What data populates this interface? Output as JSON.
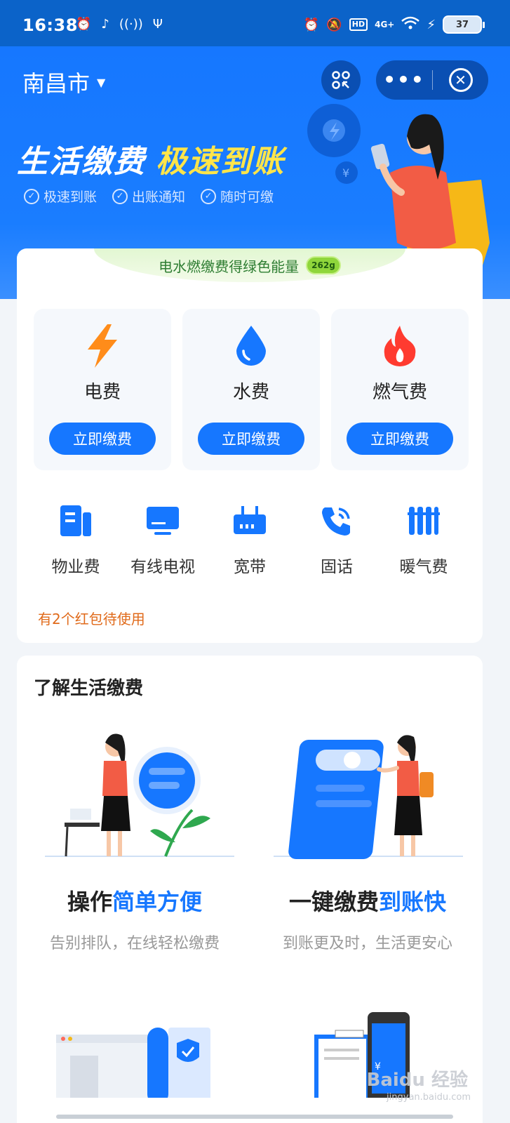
{
  "status_bar": {
    "time": "16:38",
    "battery": "37",
    "hd": "HD",
    "net": "4G+"
  },
  "header": {
    "city": "南昌市",
    "more_label": "•••"
  },
  "hero": {
    "headline_a": "生活缴费",
    "headline_b": "极速到账",
    "features": [
      "极速到账",
      "出账通知",
      "随时可缴"
    ]
  },
  "energy_banner": {
    "text": "电水燃缴费得绿色能量",
    "badge": "262g"
  },
  "utilities": [
    {
      "label": "电费",
      "button": "立即缴费",
      "icon": "lightning-icon"
    },
    {
      "label": "水费",
      "button": "立即缴费",
      "icon": "water-drop-icon"
    },
    {
      "label": "燃气费",
      "button": "立即缴费",
      "icon": "flame-icon"
    }
  ],
  "services": [
    {
      "label": "物业费",
      "icon": "building-icon"
    },
    {
      "label": "有线电视",
      "icon": "tv-icon"
    },
    {
      "label": "宽带",
      "icon": "router-icon"
    },
    {
      "label": "固话",
      "icon": "phone-icon"
    },
    {
      "label": "暖气费",
      "icon": "radiator-icon"
    }
  ],
  "promo": "有2个红包待使用",
  "learn": {
    "title": "了解生活缴费",
    "items": [
      {
        "title_a": "操作",
        "title_b": "简单方便",
        "desc": "告别排队，在线轻松缴费"
      },
      {
        "title_a": "一键缴费",
        "title_b": "到账快",
        "desc": "到账更及时，生活更安心"
      }
    ]
  },
  "watermark": {
    "main": "Baidu 经验",
    "sub": "jingyan.baidu.com"
  },
  "colors": {
    "primary": "#1677ff",
    "hero_bg": "#1a7dff",
    "status_bar": "#0b63c9",
    "promo": "#e06a1a",
    "flame": "#ff3b30",
    "lightning": "#ff8c1a"
  }
}
